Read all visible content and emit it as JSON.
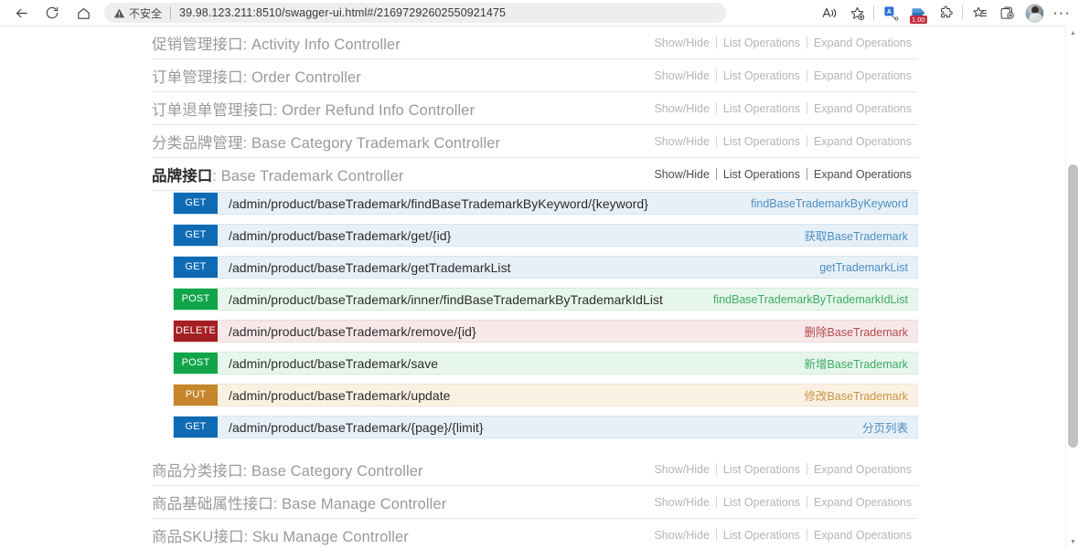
{
  "browser": {
    "nav": {
      "back_label": "Back",
      "refresh_label": "Refresh",
      "home_label": "Home"
    },
    "address": {
      "security_label": "不安全",
      "url": "39.98.123.211:8510/swagger-ui.html#/21697292602550921475",
      "url_host": "39.98.123.211:8510",
      "url_path": "/swagger-ui.html#/21697292602550921475"
    },
    "toolbar": {
      "read_aloud": "A",
      "add_favorite": "Add to favorites",
      "translate_badge": "A",
      "zoom_badge": "1.00",
      "extensions": "Extensions",
      "collections": "Collections",
      "add_collection": "Add collection",
      "profile": "Profile",
      "settings_more": "···"
    }
  },
  "swagger": {
    "resources_before": [
      {
        "cn": "促销管理接口",
        "en": ": Activity Info Controller",
        "show_hide": "Show/Hide",
        "list_ops": "List Operations",
        "expand_ops": "Expand Operations"
      },
      {
        "cn": "订单管理接口",
        "en": ": Order Controller",
        "show_hide": "Show/Hide",
        "list_ops": "List Operations",
        "expand_ops": "Expand Operations"
      },
      {
        "cn": "订单退单管理接口",
        "en": ": Order Refund Info Controller",
        "show_hide": "Show/Hide",
        "list_ops": "List Operations",
        "expand_ops": "Expand Operations"
      },
      {
        "cn": "分类品牌管理",
        "en": ": Base Category Trademark Controller",
        "show_hide": "Show/Hide",
        "list_ops": "List Operations",
        "expand_ops": "Expand Operations"
      }
    ],
    "active_resource": {
      "cn": "品牌接口",
      "en": ": Base Trademark Controller",
      "show_hide": "Show/Hide",
      "list_ops": "List Operations",
      "expand_ops": "Expand Operations"
    },
    "endpoints": [
      {
        "method": "GET",
        "method_class": "get",
        "path": "/admin/product/baseTrademark/findBaseTrademarkByKeyword/{keyword}",
        "desc": "findBaseTrademarkByKeyword"
      },
      {
        "method": "GET",
        "method_class": "get",
        "path": "/admin/product/baseTrademark/get/{id}",
        "desc": "获取BaseTrademark"
      },
      {
        "method": "GET",
        "method_class": "get",
        "path": "/admin/product/baseTrademark/getTrademarkList",
        "desc": "getTrademarkList"
      },
      {
        "method": "POST",
        "method_class": "post",
        "path": "/admin/product/baseTrademark/inner/findBaseTrademarkByTrademarkIdList",
        "desc": "findBaseTrademarkByTrademarkIdList"
      },
      {
        "method": "DELETE",
        "method_class": "delete",
        "path": "/admin/product/baseTrademark/remove/{id}",
        "desc": "删除BaseTrademark"
      },
      {
        "method": "POST",
        "method_class": "post",
        "path": "/admin/product/baseTrademark/save",
        "desc": "新增BaseTrademark"
      },
      {
        "method": "PUT",
        "method_class": "put",
        "path": "/admin/product/baseTrademark/update",
        "desc": "修改BaseTrademark"
      },
      {
        "method": "GET",
        "method_class": "get",
        "path": "/admin/product/baseTrademark/{page}/{limit}",
        "desc": "分页列表"
      }
    ],
    "resources_after": [
      {
        "cn": "商品分类接口",
        "en": ": Base Category Controller",
        "show_hide": "Show/Hide",
        "list_ops": "List Operations",
        "expand_ops": "Expand Operations"
      },
      {
        "cn": "商品基础属性接口",
        "en": ": Base Manage Controller",
        "show_hide": "Show/Hide",
        "list_ops": "List Operations",
        "expand_ops": "Expand Operations"
      },
      {
        "cn": "商品SKU接口",
        "en": ": Sku Manage Controller",
        "show_hide": "Show/Hide",
        "list_ops": "List Operations",
        "expand_ops": "Expand Operations"
      }
    ]
  },
  "colors": {
    "get": "#0f6ab4",
    "post": "#10a54a",
    "delete": "#a41e22",
    "put": "#c5862b"
  }
}
